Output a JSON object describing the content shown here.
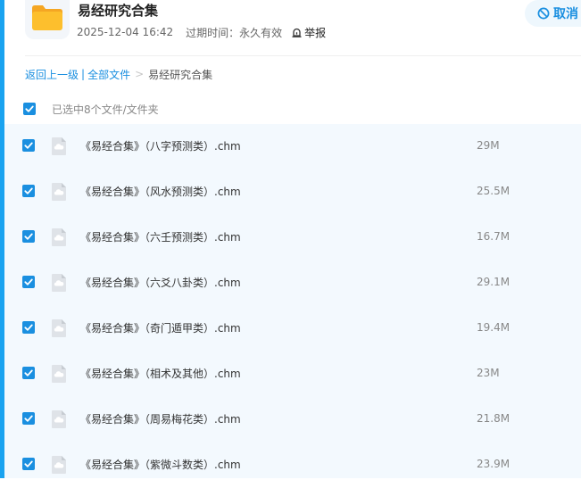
{
  "header": {
    "title": "易经研究合集",
    "date": "2025-12-04 16:42",
    "expiry_label": "过期时间：",
    "expiry_value": "永久有效",
    "report_label": "举报",
    "cancel_label": "取消"
  },
  "breadcrumb": {
    "back": "返回上一级",
    "divider": "|",
    "all_files": "全部文件",
    "separator": ">",
    "current": "易经研究合集"
  },
  "selection": {
    "text": "已选中8个文件/文件夹",
    "all_checked": true
  },
  "colors": {
    "accent": "#1a8fe0",
    "row_background": "#f3f9fe",
    "folder": "#fdbf2d"
  },
  "files": [
    {
      "name": "《易经合集》（八字预测类）.chm",
      "size": "29M",
      "checked": true
    },
    {
      "name": "《易经合集》（风水预测类）.chm",
      "size": "25.5M",
      "checked": true
    },
    {
      "name": "《易经合集》（六壬预测类）.chm",
      "size": "16.7M",
      "checked": true
    },
    {
      "name": "《易经合集》（六爻八卦类）.chm",
      "size": "29.1M",
      "checked": true
    },
    {
      "name": "《易经合集》（奇门遁甲类）.chm",
      "size": "19.4M",
      "checked": true
    },
    {
      "name": "《易经合集》（相术及其他）.chm",
      "size": "23M",
      "checked": true
    },
    {
      "name": "《易经合集》（周易梅花类）.chm",
      "size": "21.8M",
      "checked": true
    },
    {
      "name": "《易经合集》（紫微斗数类）.chm",
      "size": "23.9M",
      "checked": true
    }
  ]
}
